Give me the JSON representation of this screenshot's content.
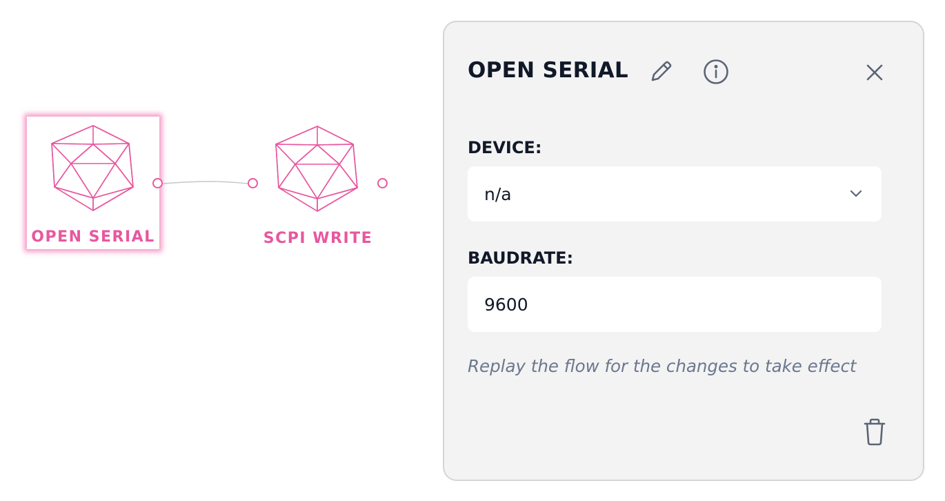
{
  "flow": {
    "nodes": [
      {
        "label": "OPEN SERIAL",
        "icon": "icosahedron-icon",
        "selected": true
      },
      {
        "label": "SCPI WRITE",
        "icon": "icosahedron-icon",
        "selected": false
      }
    ],
    "accent_color": "#e8579f"
  },
  "panel": {
    "title": "OPEN SERIAL",
    "edit_icon": "pencil-icon",
    "info_icon": "info-icon",
    "close_icon": "close-icon",
    "delete_icon": "trash-icon",
    "fields": {
      "device": {
        "label": "DEVICE:",
        "value": "n/a"
      },
      "baudrate": {
        "label": "BAUDRATE:",
        "value": "9600"
      }
    },
    "hint": "Replay the flow for the changes to take effect"
  }
}
